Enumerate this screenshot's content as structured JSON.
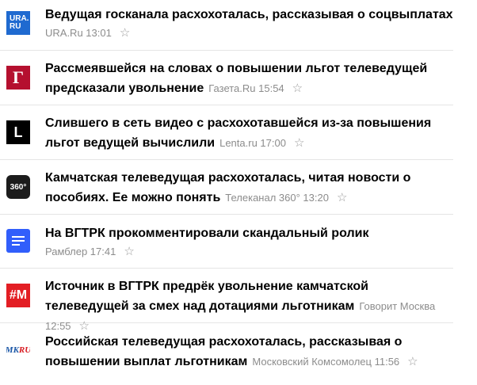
{
  "news": [
    {
      "logo_text": "URA.\nRU",
      "logo_line1": "URA.",
      "logo_line2": "RU",
      "headline": "Ведущая госканала расхохоталась, рассказывая о соцвыплатах",
      "source_time": "URA.Ru 13:01",
      "logo_icon": "ura-ru-logo-icon"
    },
    {
      "logo_text": "Г",
      "headline": "Рассмеявшейся на словах о повышении льгот телеведущей предсказали увольнение",
      "source_time": "Газета.Ru 15:54",
      "logo_icon": "gazeta-ru-logo-icon"
    },
    {
      "logo_text": "L",
      "headline": "Слившего в сеть видео с расхохотавшейся из-за повышения льгот ведущей вычислили",
      "source_time": "Lenta.ru 17:00",
      "logo_icon": "lenta-ru-logo-icon"
    },
    {
      "logo_text": "360°",
      "headline": "Камчатская телеведущая расхохоталась, читая новости о пособиях. Ее можно понять",
      "source_time": "Телеканал 360° 13:20",
      "logo_icon": "360-logo-icon"
    },
    {
      "headline": "На ВГТРК прокомментировали скандальный ролик",
      "source_time": "Рамблер 17:41",
      "logo_icon": "rambler-logo-icon"
    },
    {
      "logo_text": "#M",
      "headline": "Источник в ВГТРК предрёк увольнение камчатской телеведущей за смех над дотациями льготникам",
      "source_time": "Говорит Москва 12:55",
      "logo_icon": "govorit-moskva-logo-icon"
    },
    {
      "logo_text_blue": "MK",
      "logo_text_red": "RU",
      "headline": "Российская телеведущая расхохоталась, рассказывая о повышении выплат льготникам",
      "source_time": "Московский Комсомолец 11:56",
      "logo_icon": "mk-ru-logo-icon"
    }
  ],
  "star_glyph": "☆",
  "colors": {
    "ura": "#1f6ad0",
    "gazeta": "#b5102f",
    "lenta": "#000000",
    "tv360": "#1c1c1c",
    "rambler": "#315efb",
    "govorit_moskva": "#e31e24",
    "mk_blue": "#1a56a6",
    "mk_red": "#d71920",
    "meta_text": "#8c8c8c",
    "divider": "#e5e5e5"
  }
}
